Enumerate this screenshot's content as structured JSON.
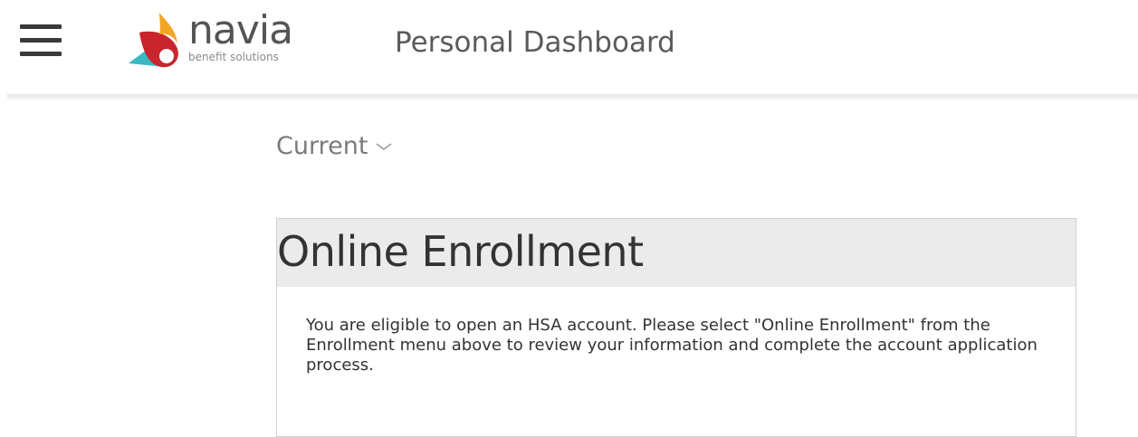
{
  "header": {
    "menu_icon": "hamburger-menu-icon",
    "logo": {
      "name": "navia",
      "tagline": "benefit solutions",
      "colors": [
        "#f2a626",
        "#c8252c",
        "#3ab7c1"
      ]
    },
    "title": "Personal Dashboard"
  },
  "period_selector": {
    "label": "Current",
    "icon": "chevron-down-icon"
  },
  "enrollment_card": {
    "title": "Online Enrollment",
    "message": "You are eligible to open an HSA account.  Please select \"Online Enrollment\" from the Enrollment menu above to review your information and complete the account application process."
  }
}
